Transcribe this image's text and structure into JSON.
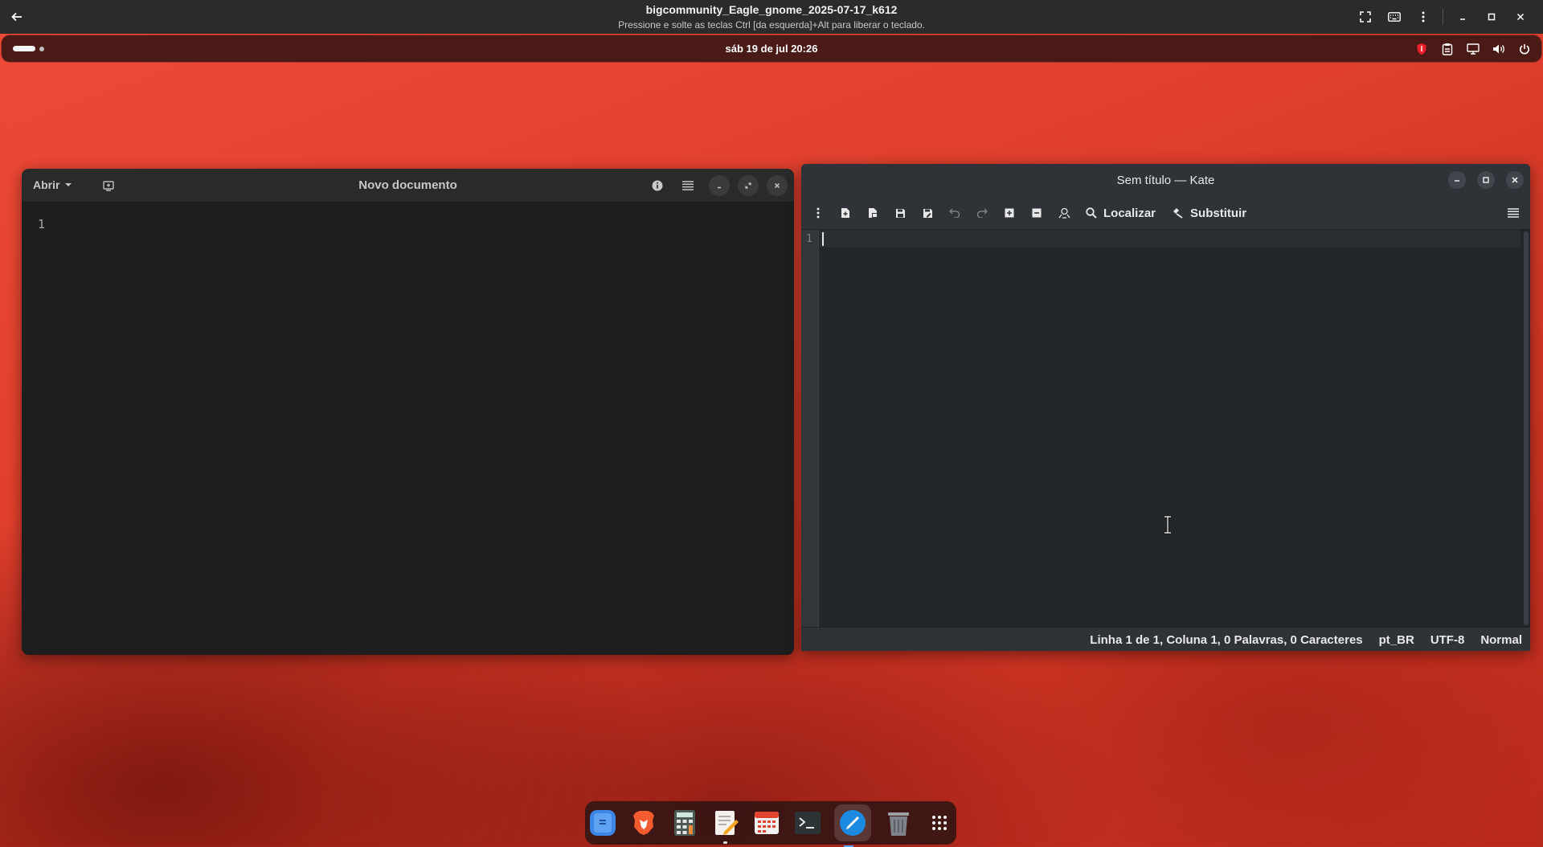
{
  "vm": {
    "title": "bigcommunity_Eagle_gnome_2025-07-17_k612",
    "subtitle": "Pressione e solte as teclas Ctrl [da esquerda]+Alt para liberar o teclado."
  },
  "panel": {
    "clock": "sáb 19 de jul  20:26"
  },
  "gnome_editor": {
    "open_label": "Abrir",
    "title": "Novo documento",
    "line_number": "1"
  },
  "kate": {
    "title": "Sem título  — Kate",
    "find_label": "Localizar",
    "replace_label": "Substituir",
    "line_number": "1",
    "status": {
      "position": "Linha 1 de 1, Coluna 1, 0 Palavras, 0 Caracteres",
      "language": "pt_BR",
      "encoding": "UTF-8",
      "mode": "Normal"
    }
  },
  "dock": {
    "items": [
      "files-icon",
      "brave-icon",
      "calculator-icon",
      "text-editor-icon",
      "calendar-icon",
      "terminal-icon",
      "kate-icon",
      "trash-icon",
      "app-grid-icon"
    ]
  },
  "colors": {
    "accent": "#4da3ff",
    "panel": "#4a1a16",
    "wallpaper": "#e2402e"
  }
}
